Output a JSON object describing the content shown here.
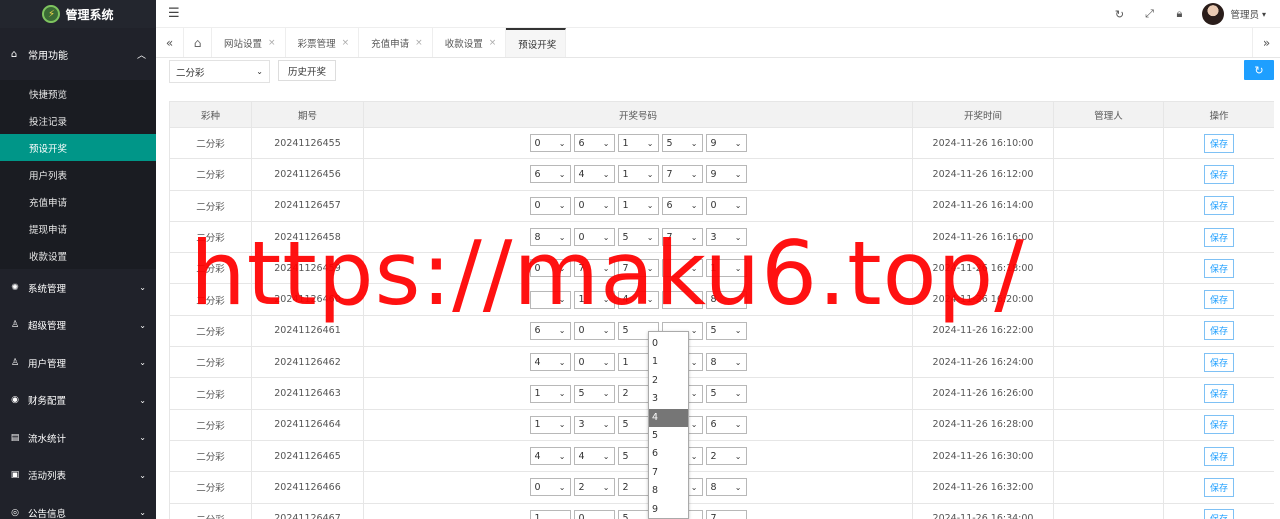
{
  "app": {
    "title": "管理系统"
  },
  "sidebar": {
    "group_main": {
      "label": "常用功能",
      "icon": "home-icon"
    },
    "items": [
      {
        "label": "快捷预览",
        "active": false
      },
      {
        "label": "投注记录",
        "active": false
      },
      {
        "label": "预设开奖",
        "active": true
      },
      {
        "label": "用户列表",
        "active": false
      },
      {
        "label": "充值申请",
        "active": false
      },
      {
        "label": "提现申请",
        "active": false
      },
      {
        "label": "收款设置",
        "active": false
      }
    ],
    "groups": [
      {
        "label": "系统管理",
        "icon": "gear-icon"
      },
      {
        "label": "超级管理",
        "icon": "user-icon"
      },
      {
        "label": "用户管理",
        "icon": "users-icon"
      },
      {
        "label": "财务配置",
        "icon": "finance-icon"
      },
      {
        "label": "流水统计",
        "icon": "stats-icon"
      },
      {
        "label": "活动列表",
        "icon": "gift-icon"
      },
      {
        "label": "公告信息",
        "icon": "notice-icon"
      }
    ]
  },
  "header": {
    "username": "管理员"
  },
  "tabs": [
    {
      "label": "网站设置",
      "active": false
    },
    {
      "label": "彩票管理",
      "active": false
    },
    {
      "label": "充值申请",
      "active": false
    },
    {
      "label": "收款设置",
      "active": false
    },
    {
      "label": "预设开奖",
      "active": true
    }
  ],
  "toolbar": {
    "lottery_select": "二分彩",
    "history_label": "历史开奖"
  },
  "table": {
    "headers": [
      "彩种",
      "期号",
      "开奖号码",
      "开奖时间",
      "管理人",
      "操作"
    ],
    "save_label": "保存",
    "rows": [
      {
        "kind": "二分彩",
        "issue": "20241126455",
        "numbers": [
          "0",
          "6",
          "1",
          "5",
          "9"
        ],
        "time": "2024-11-26 16:10:00",
        "manager": ""
      },
      {
        "kind": "二分彩",
        "issue": "20241126456",
        "numbers": [
          "6",
          "4",
          "1",
          "7",
          "9"
        ],
        "time": "2024-11-26 16:12:00",
        "manager": ""
      },
      {
        "kind": "二分彩",
        "issue": "20241126457",
        "numbers": [
          "0",
          "0",
          "1",
          "6",
          "0"
        ],
        "time": "2024-11-26 16:14:00",
        "manager": ""
      },
      {
        "kind": "二分彩",
        "issue": "20241126458",
        "numbers": [
          "8",
          "0",
          "5",
          "7",
          "3"
        ],
        "time": "2024-11-26 16:16:00",
        "manager": ""
      },
      {
        "kind": "二分彩",
        "issue": "20241126459",
        "numbers": [
          "0",
          "7",
          "7",
          "",
          "1"
        ],
        "time": "2024-11-26 16:18:00",
        "manager": ""
      },
      {
        "kind": "二分彩",
        "issue": "20241126460",
        "numbers": [
          "",
          "1",
          "4",
          "",
          "8"
        ],
        "time": "2024-11-26 16:20:00",
        "manager": ""
      },
      {
        "kind": "二分彩",
        "issue": "20241126461",
        "numbers": [
          "6",
          "0",
          "5",
          "",
          "5"
        ],
        "time": "2024-11-26 16:22:00",
        "manager": ""
      },
      {
        "kind": "二分彩",
        "issue": "20241126462",
        "numbers": [
          "4",
          "0",
          "1",
          "",
          "8"
        ],
        "time": "2024-11-26 16:24:00",
        "manager": ""
      },
      {
        "kind": "二分彩",
        "issue": "20241126463",
        "numbers": [
          "1",
          "5",
          "2",
          "",
          "5"
        ],
        "time": "2024-11-26 16:26:00",
        "manager": ""
      },
      {
        "kind": "二分彩",
        "issue": "20241126464",
        "numbers": [
          "1",
          "3",
          "5",
          "",
          "6"
        ],
        "time": "2024-11-26 16:28:00",
        "manager": ""
      },
      {
        "kind": "二分彩",
        "issue": "20241126465",
        "numbers": [
          "4",
          "4",
          "5",
          "",
          "2"
        ],
        "time": "2024-11-26 16:30:00",
        "manager": ""
      },
      {
        "kind": "二分彩",
        "issue": "20241126466",
        "numbers": [
          "0",
          "2",
          "2",
          "",
          "8"
        ],
        "time": "2024-11-26 16:32:00",
        "manager": ""
      },
      {
        "kind": "二分彩",
        "issue": "20241126467",
        "numbers": [
          "1",
          "0",
          "5",
          "",
          "7"
        ],
        "time": "2024-11-26 16:34:00",
        "manager": ""
      }
    ]
  },
  "dropdown": {
    "options": [
      "0",
      "1",
      "2",
      "3",
      "4",
      "5",
      "6",
      "7",
      "8",
      "9"
    ],
    "selected": "4"
  },
  "watermark": "https://maku6.top/"
}
